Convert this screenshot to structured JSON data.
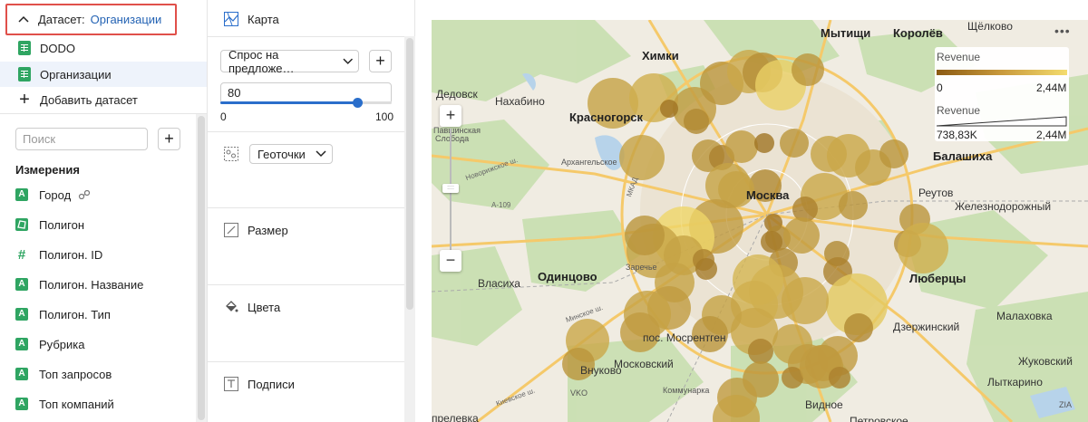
{
  "dataset_panel": {
    "label": "Датасет:",
    "current": "Организации",
    "datasets": [
      {
        "name": "DODO",
        "active": false
      },
      {
        "name": "Организации",
        "active": true
      }
    ],
    "add_dataset_label": "Добавить датасет",
    "search_placeholder": "Поиск",
    "add_field_label": "+",
    "dimensions_title": "Измерения",
    "dimensions": [
      {
        "name": "Город",
        "icon": "string-field-icon",
        "linked": true
      },
      {
        "name": "Полигон",
        "icon": "polygon-field-icon",
        "linked": false
      },
      {
        "name": "Полигон. ID",
        "icon": "number-field-icon",
        "linked": false
      },
      {
        "name": "Полигон. Название",
        "icon": "string-field-icon",
        "linked": false
      },
      {
        "name": "Полигон. Тип",
        "icon": "string-field-icon",
        "linked": false
      },
      {
        "name": "Рубрика",
        "icon": "string-field-icon",
        "linked": false
      },
      {
        "name": "Топ запросов",
        "icon": "string-field-icon",
        "linked": false
      },
      {
        "name": "Топ компаний",
        "icon": "string-field-icon",
        "linked": false
      }
    ],
    "string_glyph": "A",
    "number_glyph": "#"
  },
  "settings_panel": {
    "map_label": "Карта",
    "measure_select": "Спрос на предложе…",
    "add_label": "+",
    "opacity_value": "80",
    "opacity_fraction": 0.8,
    "slider_min": "0",
    "slider_max": "100",
    "geo_select": "Геоточки",
    "size_label": "Размер",
    "colors_label": "Цвета",
    "labels_label": "Подписи"
  },
  "map": {
    "zoom_in": "+",
    "zoom_out": "−",
    "menu": "•••",
    "legend": {
      "color_title": "Revenue",
      "color_min": "0",
      "color_max": "2,44M",
      "size_title": "Revenue",
      "size_min": "738,83K",
      "size_max": "2,44M"
    },
    "places": [
      {
        "text": "Мытищи",
        "cls": "big"
      },
      {
        "text": "Королёв",
        "cls": "big"
      },
      {
        "text": "Щёлково",
        "cls": ""
      },
      {
        "text": "Химки",
        "cls": "big"
      },
      {
        "text": "Дедовск",
        "cls": ""
      },
      {
        "text": "Нахабино",
        "cls": ""
      },
      {
        "text": "Красногорск",
        "cls": "big"
      },
      {
        "text": "Павшинская",
        "cls": "small"
      },
      {
        "text": "Слобода",
        "cls": "small"
      },
      {
        "text": "Архангельское",
        "cls": "small"
      },
      {
        "text": "Новорижское ш.",
        "cls": "road"
      },
      {
        "text": "A-109",
        "cls": "road"
      },
      {
        "text": "МКАД",
        "cls": "road"
      },
      {
        "text": "Москва",
        "cls": "big"
      },
      {
        "text": "Реутов",
        "cls": ""
      },
      {
        "text": "Балашиха",
        "cls": "big"
      },
      {
        "text": "Железнодорожный",
        "cls": ""
      },
      {
        "text": "Заречье",
        "cls": "small"
      },
      {
        "text": "Одинцово",
        "cls": "big"
      },
      {
        "text": "Власиха",
        "cls": ""
      },
      {
        "text": "Люберцы",
        "cls": "big"
      },
      {
        "text": "Дзержинский",
        "cls": ""
      },
      {
        "text": "Малаховка",
        "cls": ""
      },
      {
        "text": "пос. Мосрентген",
        "cls": ""
      },
      {
        "text": "Минское ш.",
        "cls": "road"
      },
      {
        "text": "Московский",
        "cls": ""
      },
      {
        "text": "Жуковский",
        "cls": ""
      },
      {
        "text": "Лыткарино",
        "cls": ""
      },
      {
        "text": "Коммунарка",
        "cls": "small"
      },
      {
        "text": "Видное",
        "cls": ""
      },
      {
        "text": "Внуково",
        "cls": ""
      },
      {
        "text": "VKO",
        "cls": "small"
      },
      {
        "text": "Киевское ш.",
        "cls": "road"
      },
      {
        "text": "Петровское",
        "cls": ""
      },
      {
        "text": "ZIA",
        "cls": "small"
      },
      {
        "text": "прелевка",
        "cls": ""
      }
    ]
  },
  "colors": {
    "accent": "#2a6ecb",
    "highlight_border": "#e0504a",
    "field_green": "#2fa562",
    "bubble_dark": "#8b5a12",
    "bubble_light": "#f4dc6e"
  }
}
